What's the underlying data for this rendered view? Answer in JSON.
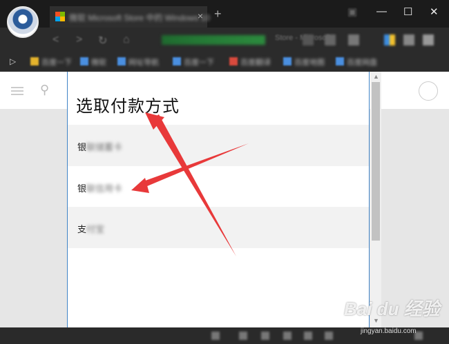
{
  "browser": {
    "tab_title": "微软 Microsoft Store 中的 Windows 10",
    "tab_close": "×",
    "new_tab": "+",
    "window_controls": {
      "minimize": "—",
      "maximize": "☐",
      "close": "✕"
    },
    "address_text": "Store - Microsoft",
    "nav": {
      "back": "<",
      "forward": ">",
      "reload": "↻",
      "home": "⌂"
    },
    "extensions": [
      "blue",
      "green",
      "yellow",
      "gray"
    ],
    "bookmarks_toggle": "▷",
    "bookmarks": [
      {
        "label": "百度一下",
        "icon": "yellow-icon"
      },
      {
        "label": "微软",
        "icon": "blue-icon"
      },
      {
        "label": "网址导航",
        "icon": "blue-icon"
      },
      {
        "label": "百度一下",
        "icon": "blue-icon"
      },
      {
        "label": "百度翻译",
        "icon": "red-icon"
      },
      {
        "label": "百度地图",
        "icon": "blue-icon"
      },
      {
        "label": "百度网盘",
        "icon": "blue-icon"
      }
    ]
  },
  "page": {
    "menu_icon": "hamburger-icon",
    "search_icon": "search-icon",
    "account_icon": "user-icon"
  },
  "dialog": {
    "title": "选取付款方式",
    "options": [
      {
        "head": "银",
        "rest": "联储蓄卡"
      },
      {
        "head": "银",
        "rest": "联信用卡"
      },
      {
        "head": "支",
        "rest": "付宝"
      }
    ]
  },
  "watermark": {
    "brand": "Bai du 经验",
    "url": "jingyan.baidu.com"
  },
  "colors": {
    "arrow": "#e8393a",
    "dialog_border": "#3f83c6",
    "chrome_dark": "#1b1b1b"
  }
}
